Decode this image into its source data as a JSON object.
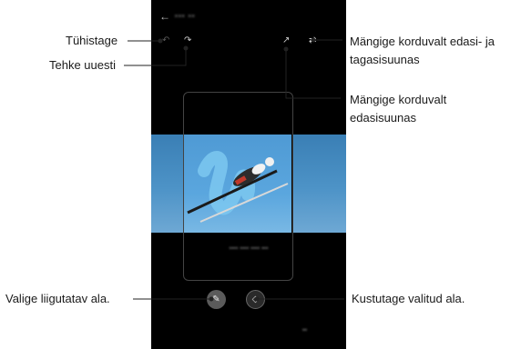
{
  "labels": {
    "undo": "Tühistage",
    "redo": "Tehke uuesti",
    "repeat_both": "Mängige korduvalt edasi- ja tagasisuunas",
    "repeat_forward": "Mängige korduvalt edasisuunas",
    "move_area": "Valige liigutatav ala.",
    "erase_area": "Kustutage valitud ala."
  },
  "icons": {
    "back": "back-arrow-icon",
    "undo": "undo-icon",
    "redo": "redo-icon",
    "repeat_forward": "bounce-forward-icon",
    "repeat_both": "repeat-icon",
    "move": "brush-icon",
    "erase": "eraser-icon"
  },
  "colors": {
    "screen_bg": "#000000",
    "sky": "#4d93c7"
  }
}
